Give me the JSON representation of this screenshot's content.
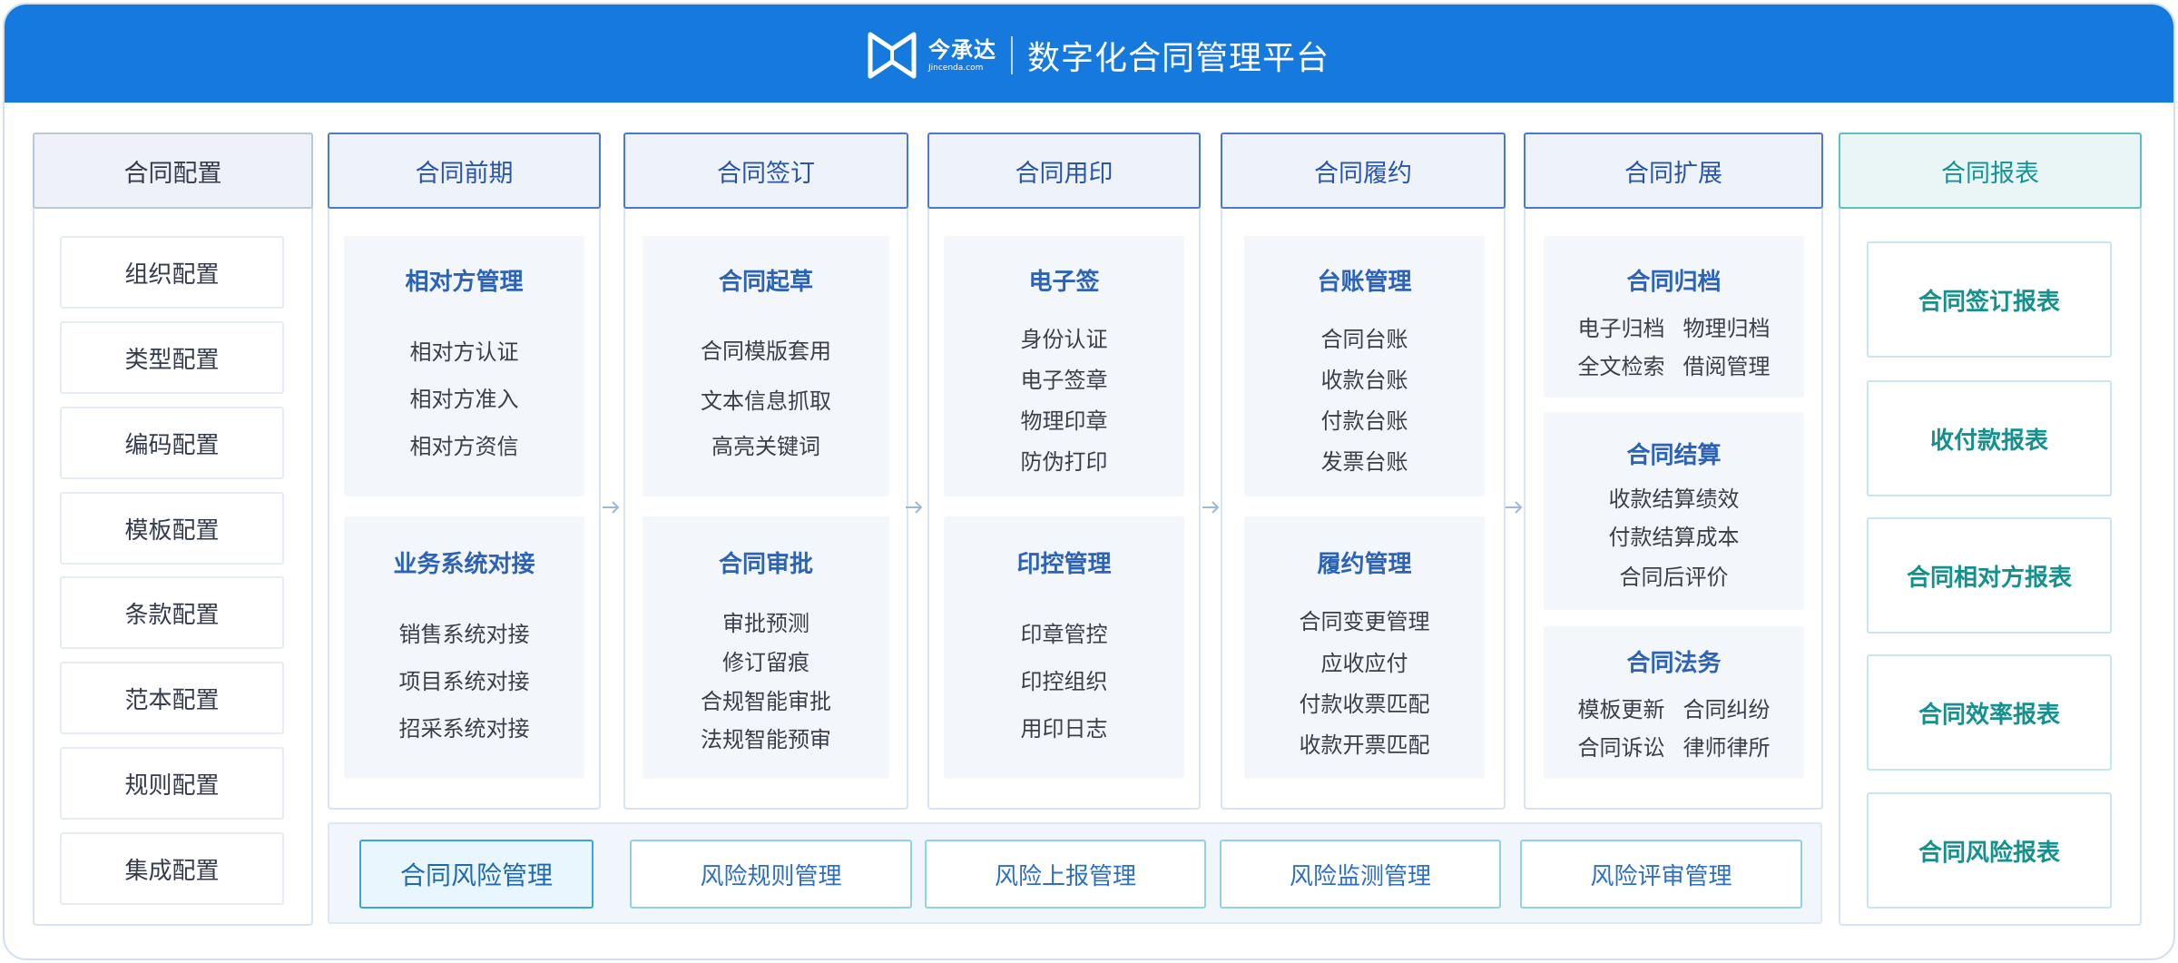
{
  "header": {
    "logo_name": "今承达",
    "logo_domain": "Jincenda.com",
    "title": "数字化合同管理平台"
  },
  "config": {
    "head": "合同配置",
    "items": [
      "组织配置",
      "类型配置",
      "编码配置",
      "模板配置",
      "条款配置",
      "范本配置",
      "规则配置",
      "集成配置"
    ]
  },
  "phases": [
    {
      "head": "合同前期",
      "cards": [
        {
          "title": "相对方管理",
          "lines": [
            "相对方认证",
            "相对方准入",
            "相对方资信"
          ]
        },
        {
          "title": "业务系统对接",
          "lines": [
            "销售系统对接",
            "项目系统对接",
            "招采系统对接"
          ]
        }
      ]
    },
    {
      "head": "合同签订",
      "cards": [
        {
          "title": "合同起草",
          "lines": [
            "合同模版套用",
            "文本信息抓取",
            "高亮关键词"
          ]
        },
        {
          "title": "合同审批",
          "lines": [
            "审批预测",
            "修订留痕",
            "合规智能审批",
            "法规智能预审"
          ]
        }
      ]
    },
    {
      "head": "合同用印",
      "cards": [
        {
          "title": "电子签",
          "lines": [
            "身份认证",
            "电子签章",
            "物理印章",
            "防伪打印"
          ]
        },
        {
          "title": "印控管理",
          "lines": [
            "印章管控",
            "印控组织",
            "用印日志"
          ]
        }
      ]
    },
    {
      "head": "合同履约",
      "cards": [
        {
          "title": "台账管理",
          "lines": [
            "合同台账",
            "收款台账",
            "付款台账",
            "发票台账"
          ]
        },
        {
          "title": "履约管理",
          "lines": [
            "合同变更管理",
            "应收应付",
            "付款收票匹配",
            "收款开票匹配"
          ]
        }
      ]
    },
    {
      "head": "合同扩展",
      "cards": [
        {
          "title": "合同归档",
          "rows": [
            [
              "电子归档",
              "物理归档"
            ],
            [
              "全文检索",
              "借阅管理"
            ]
          ]
        },
        {
          "title": "合同结算",
          "lines": [
            "收款结算绩效",
            "付款结算成本",
            "合同后评价"
          ]
        },
        {
          "title": "合同法务",
          "rows": [
            [
              "模板更新",
              "合同纠纷"
            ],
            [
              "合同诉讼",
              "律师律所"
            ]
          ]
        }
      ]
    }
  ],
  "risk": {
    "main": "合同风险管理",
    "items": [
      "风险规则管理",
      "风险上报管理",
      "风险监测管理",
      "风险评审管理"
    ]
  },
  "reports": {
    "head": "合同报表",
    "items": [
      "合同签订报表",
      "收付款报表",
      "合同相对方报表",
      "合同效率报表",
      "合同风险报表"
    ]
  },
  "colors": {
    "header_bg": "#1579de",
    "accent_blue": "#2d63b7",
    "accent_teal": "#14908f"
  }
}
